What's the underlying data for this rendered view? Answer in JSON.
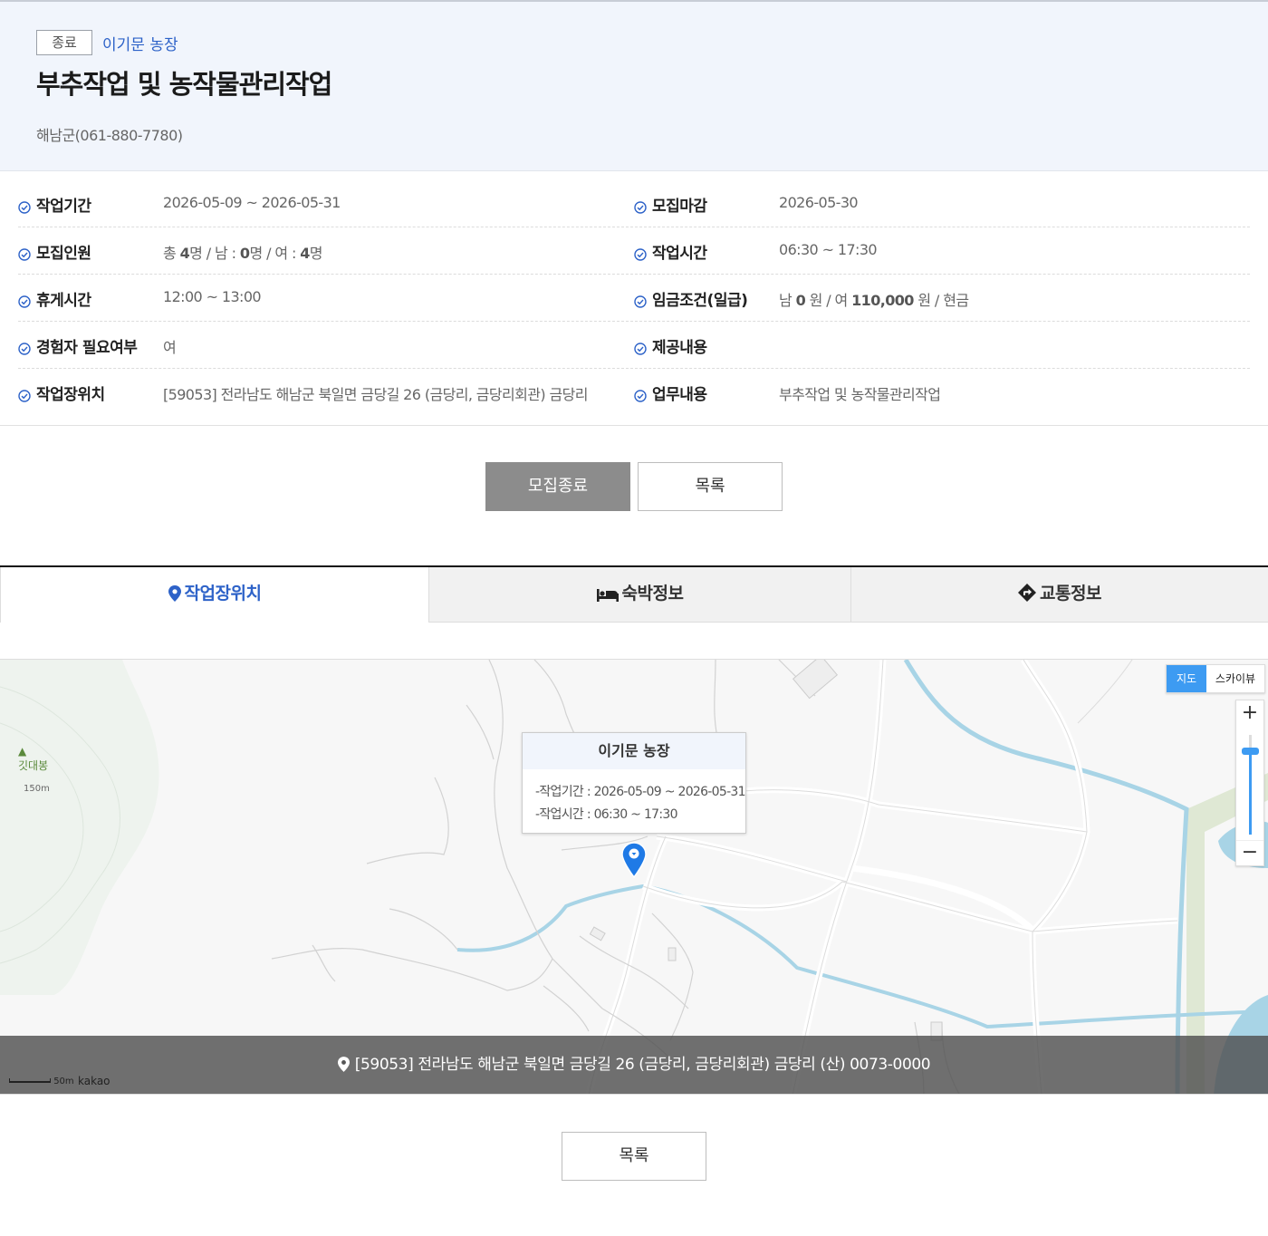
{
  "header": {
    "status": "종료",
    "farm_name": "이기문 농장",
    "title": "부추작업 및 농작물관리작업",
    "contact": "해남군(061-880-7780)"
  },
  "info": {
    "period_label": "작업기간",
    "period_value": "2026-05-09 ~ 2026-05-31",
    "deadline_label": "모집마감",
    "deadline_value": "2026-05-30",
    "recruit_label": "모집인원",
    "recruit_total_prefix": "총 ",
    "recruit_total": "4",
    "recruit_male_prefix": "명 / 남 : ",
    "recruit_male": "0",
    "recruit_female_prefix": "명 / 여 : ",
    "recruit_female": "4",
    "recruit_suffix": "명",
    "worktime_label": "작업시간",
    "worktime_value": "06:30 ~ 17:30",
    "break_label": "휴게시간",
    "break_value": "12:00 ~ 13:00",
    "wage_label": "임금조건(일급)",
    "wage_male_prefix": "남 ",
    "wage_male": "0",
    "wage_female_prefix": " 원 / 여 ",
    "wage_female": "110,000",
    "wage_suffix": " 원 / 현금",
    "experience_label": "경험자 필요여부",
    "experience_value": "여",
    "provision_label": "제공내용",
    "provision_value": "",
    "location_label": "작업장위치",
    "location_value": "[59053] 전라남도 해남군 북일면 금당길 26 (금당리, 금당리회관) 금당리",
    "task_label": "업무내용",
    "task_value": "부추작업 및 농작물관리작업"
  },
  "buttons": {
    "closed": "모집종료",
    "list": "목록"
  },
  "tabs": [
    {
      "label": "작업장위치",
      "icon": "map-pin-icon"
    },
    {
      "label": "숙박정보",
      "icon": "bed-icon"
    },
    {
      "label": "교통정보",
      "icon": "directions-icon"
    }
  ],
  "map": {
    "peak_name": "깃대봉",
    "peak_altitude": "150m",
    "type_map": "지도",
    "type_sky": "스카이뷰",
    "zoom_in": "+",
    "zoom_out": "−",
    "infowindow": {
      "title": "이기문 농장",
      "line1": "-작업기간 : 2026-05-09 ~ 2026-05-31",
      "line2": "-작업시간 : 06:30 ~ 17:30"
    },
    "address": "[59053] 전라남도 해남군 북일면 금당길 26 (금당리, 금당리회관) 금당리 (산) 0073-0000",
    "scale": "50m",
    "provider": "kakao"
  },
  "colors": {
    "accent": "#2d62c8",
    "header_bg": "#f1f5fc",
    "water": "#a8d4e6",
    "map_button": "#3d9bf2"
  }
}
